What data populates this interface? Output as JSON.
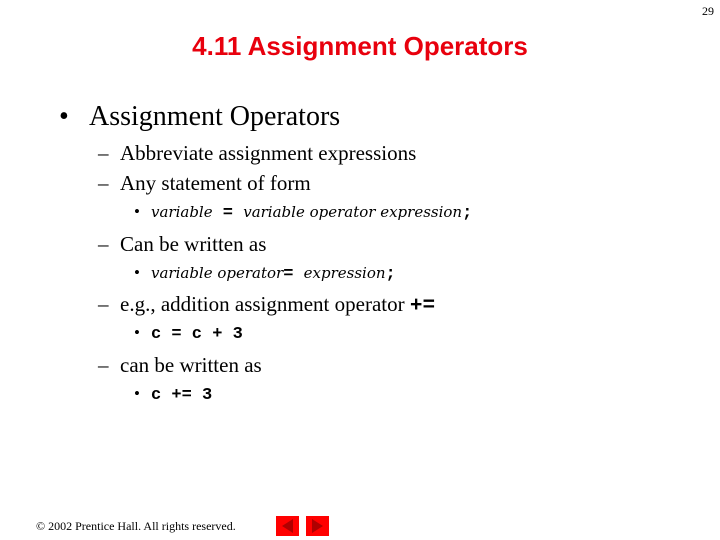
{
  "slide_number": "29",
  "title": "4.11  Assignment Operators",
  "bullet_l1": "Assignment Operators",
  "items": {
    "abbreviate": "Abbreviate assignment expressions",
    "any_statement": "Any statement of form",
    "form1": {
      "a": "variable",
      "op": " = ",
      "b": "variable operator expression",
      "semi": ";"
    },
    "can_be_written": "Can be written as",
    "form2": {
      "a": "variable operator",
      "op": "= ",
      "b": "expression",
      "semi": ";"
    },
    "eg_text": "e.g., addition assignment operator ",
    "eg_op": "+=",
    "code1": "c = c + 3",
    "can_be_written2": "can be written as",
    "code2": "c += 3"
  },
  "markers": {
    "l1": "•",
    "l2": "–",
    "l3": "•"
  },
  "footer": "© 2002 Prentice Hall.  All rights reserved.",
  "nav": {
    "prev_icon": "previous-slide-icon",
    "next_icon": "next-slide-icon",
    "color": "#ff0000"
  }
}
